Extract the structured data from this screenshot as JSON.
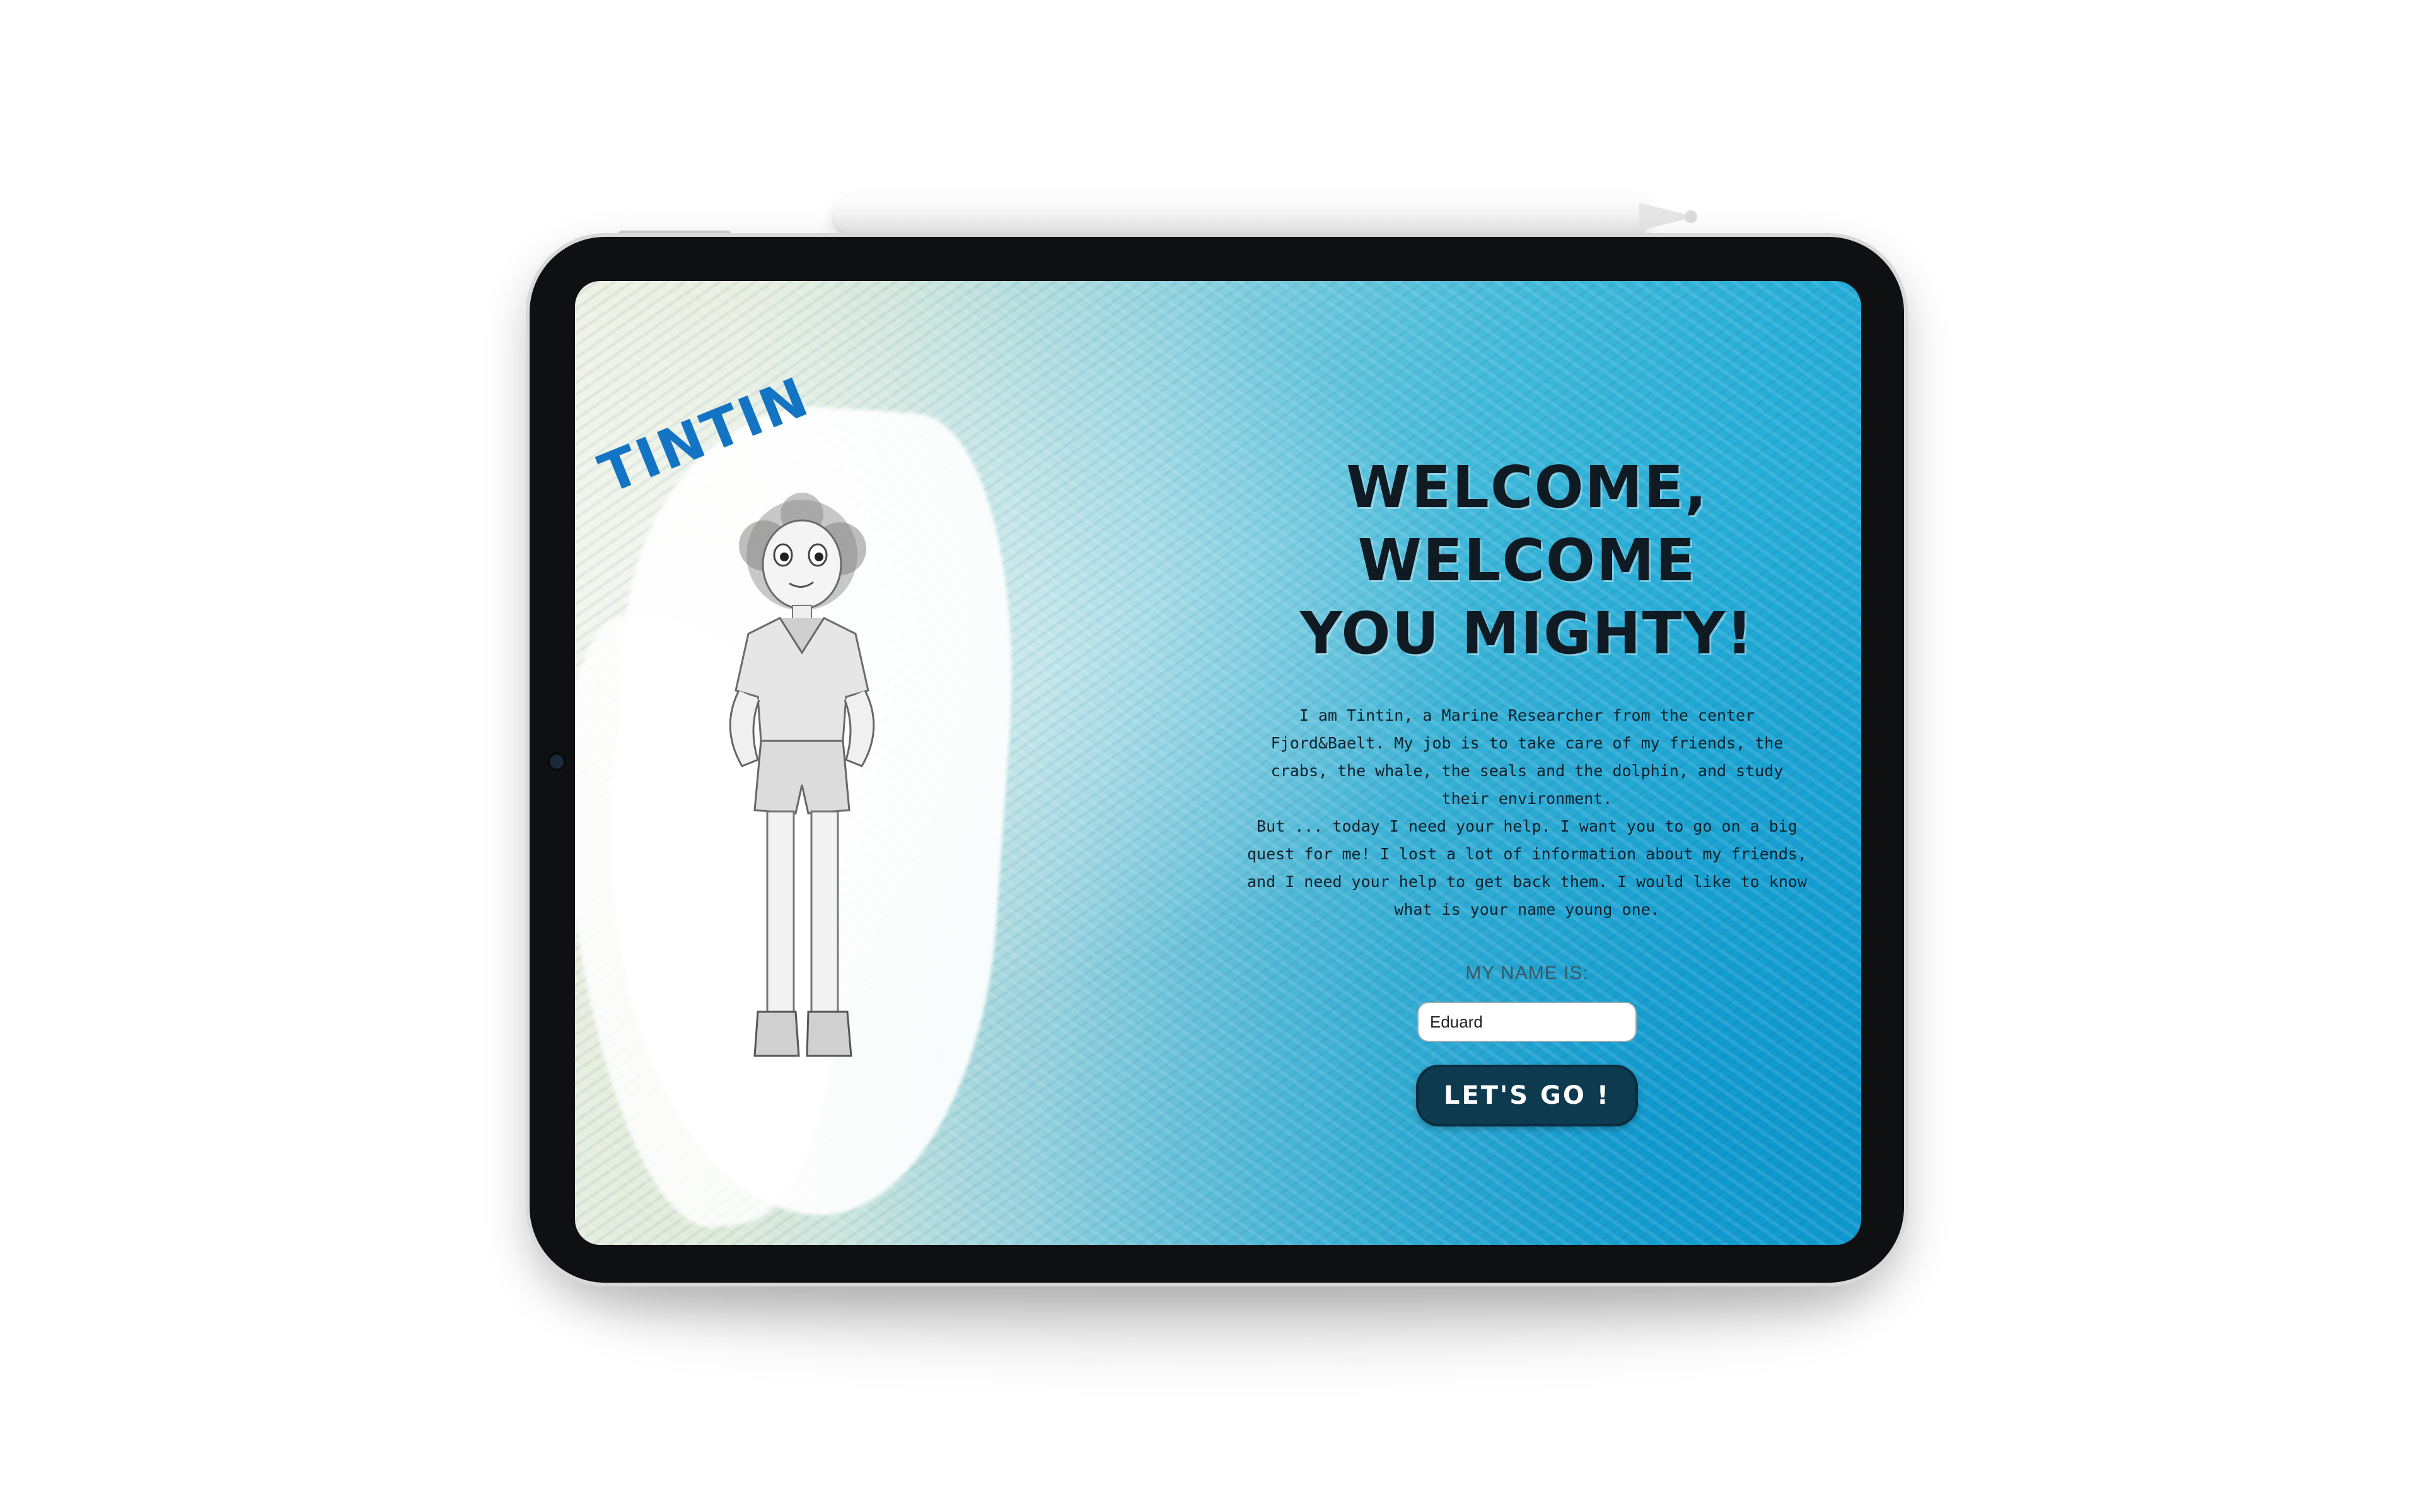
{
  "device": {
    "name": "tablet",
    "accessory": "stylus-pencil"
  },
  "page": {
    "character_name": "TINTIN",
    "headline_line1": "WELCOME, WELCOME",
    "headline_line2": "YOU MIGHTY!",
    "intro": "I am Tintin, a Marine Researcher from the center Fjord&Baelt. My job is to take care of my friends, the crabs, the whale, the seals and the dolphin, and study their environment.\nBut ... today I need your help. I want you to go on a big quest for me! I lost a lot of information about my friends, and I need your help to get back them. I would like to know what is your name young one.",
    "name_label": "MY NAME IS:",
    "name_input_value": "Eduard",
    "go_button_label": "LET'S GO !"
  },
  "colors": {
    "character_name": "#1374c4",
    "headline": "#0f1a22",
    "button_bg": "#0e3a4f",
    "watercolor_blue": "#1aa3d3",
    "watercolor_light": "#eef1e2"
  },
  "icons": {
    "illustration": "girl-character-illustration"
  }
}
